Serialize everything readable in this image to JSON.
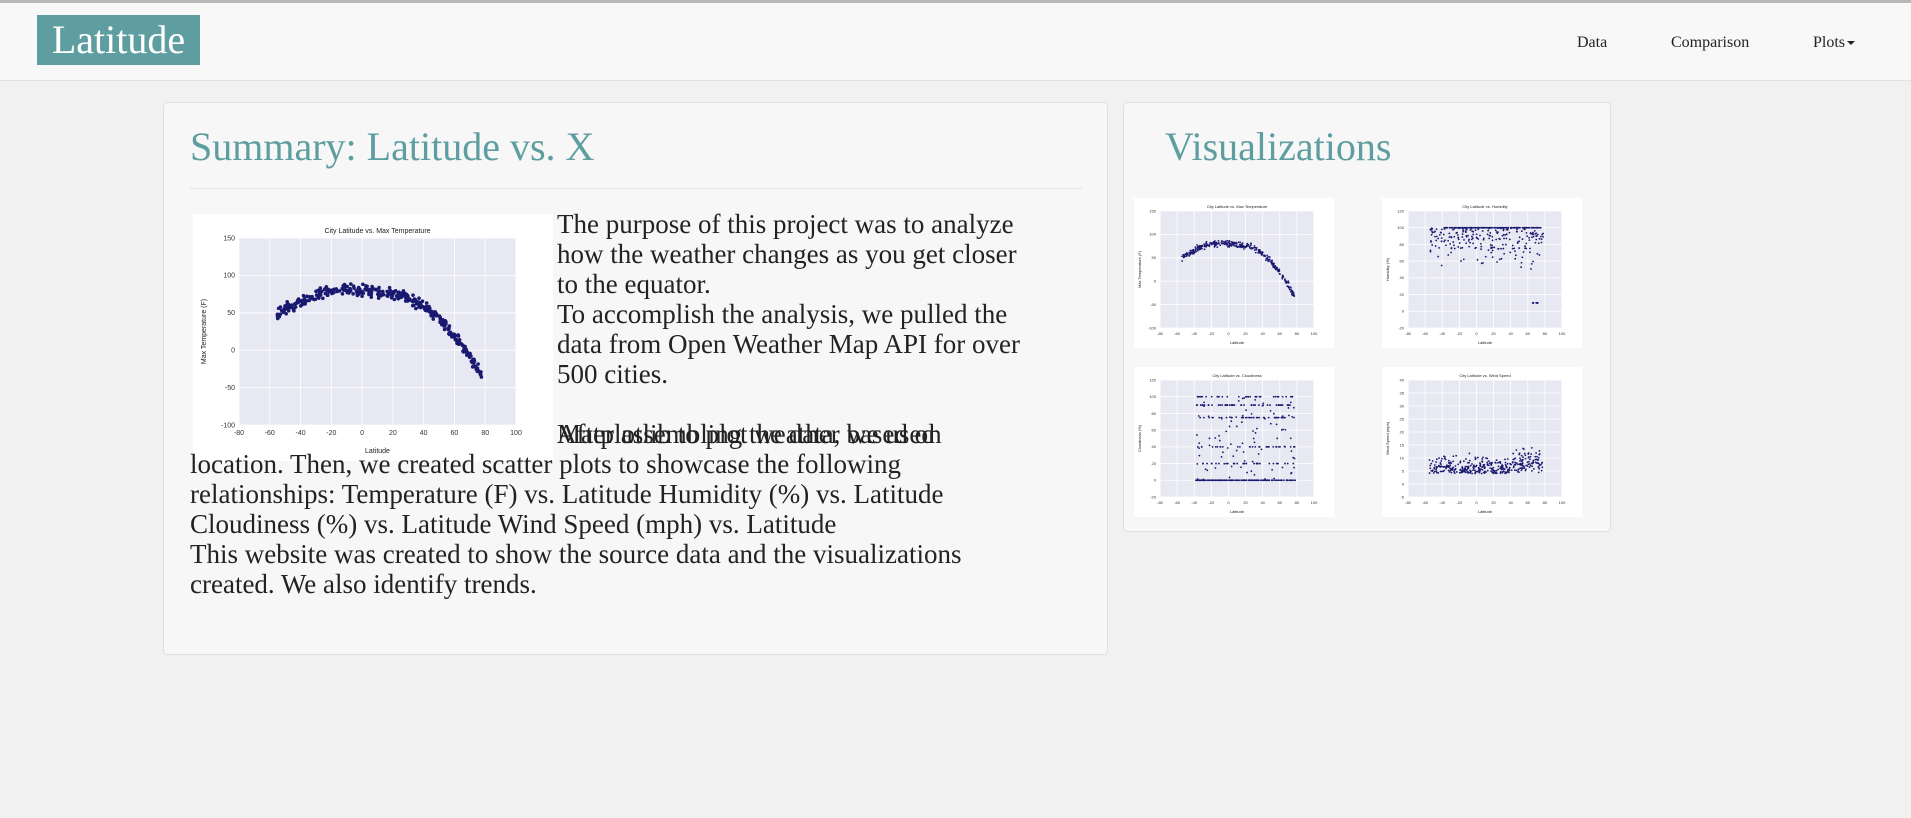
{
  "navbar": {
    "brand": "Latitude",
    "links": [
      "Data",
      "Comparison",
      "Plots"
    ]
  },
  "summary": {
    "title": "Summary: Latitude vs. X",
    "lines": [
      "The purpose of this project was to analyze",
      "how the weather changes as you get closer",
      "to the equator.",
      "To accomplish the analysis, we pulled the",
      "data from Open Weather Map API for over",
      "500 cities.",
      "After assembling the data, we used",
      "Matplotlib to plot weather based on",
      "location. Then, we created scatter plots to showcase the following",
      "relationships: Temperature (F) vs. Latitude Humidity (%) vs. Latitude",
      "Cloudiness (%) vs. Latitude Wind Speed (mph) vs. Latitude",
      "This website was created to show the source data and the visualizations",
      "created. We also identify trends."
    ]
  },
  "visualizations": {
    "title": "Visualizations"
  },
  "chart_data": [
    {
      "type": "scatter",
      "title": "City Latitude vs. Max Temperature",
      "xlabel": "Latitude",
      "ylabel": "Max Temperature (F)",
      "xlim": [
        -80,
        100
      ],
      "ylim": [
        -100,
        150
      ],
      "xticks": [
        -80,
        -60,
        -40,
        -20,
        0,
        20,
        40,
        60,
        80,
        100
      ],
      "yticks": [
        -100,
        -50,
        0,
        50,
        100,
        150
      ],
      "grid": true,
      "color": "#191970",
      "trend": {
        "x": [
          -60,
          -50,
          -40,
          -30,
          -20,
          -10,
          0,
          10,
          20,
          30,
          40,
          50,
          60,
          70,
          75,
          80
        ],
        "y": [
          42,
          55,
          66,
          74,
          79,
          81,
          80,
          78,
          75,
          70,
          58,
          42,
          18,
          -8,
          -25,
          -40
        ]
      }
    },
    {
      "type": "scatter",
      "title": "City Latitude vs. Humidity",
      "xlabel": "Latitude",
      "ylabel": "Humidity (%)",
      "xlim": [
        -80,
        100
      ],
      "ylim": [
        -20,
        120
      ],
      "xticks": [
        -80,
        -60,
        -40,
        -20,
        0,
        20,
        40,
        60,
        80,
        100
      ],
      "yticks": [
        -20,
        0,
        20,
        40,
        60,
        80,
        100,
        120
      ],
      "grid": true,
      "color": "#191970"
    },
    {
      "type": "scatter",
      "title": "City Latitude vs. Cloudiness",
      "xlabel": "Latitude",
      "ylabel": "Cloudiness (%)",
      "xlim": [
        -80,
        100
      ],
      "ylim": [
        -20,
        120
      ],
      "xticks": [
        -80,
        -60,
        -40,
        -20,
        0,
        20,
        40,
        60,
        80,
        100
      ],
      "yticks": [
        -20,
        0,
        20,
        40,
        60,
        80,
        100,
        120
      ],
      "grid": true,
      "color": "#191970"
    },
    {
      "type": "scatter",
      "title": "City Latitude vs. Wind Speed",
      "xlabel": "Latitude",
      "ylabel": "Wind Speed (mph)",
      "xlim": [
        -80,
        100
      ],
      "ylim": [
        -5,
        40
      ],
      "xticks": [
        -80,
        -60,
        -40,
        -20,
        0,
        20,
        40,
        60,
        80,
        100
      ],
      "yticks": [
        -5,
        0,
        5,
        10,
        15,
        20,
        25,
        30,
        35,
        40
      ],
      "grid": true,
      "color": "#191970"
    }
  ]
}
